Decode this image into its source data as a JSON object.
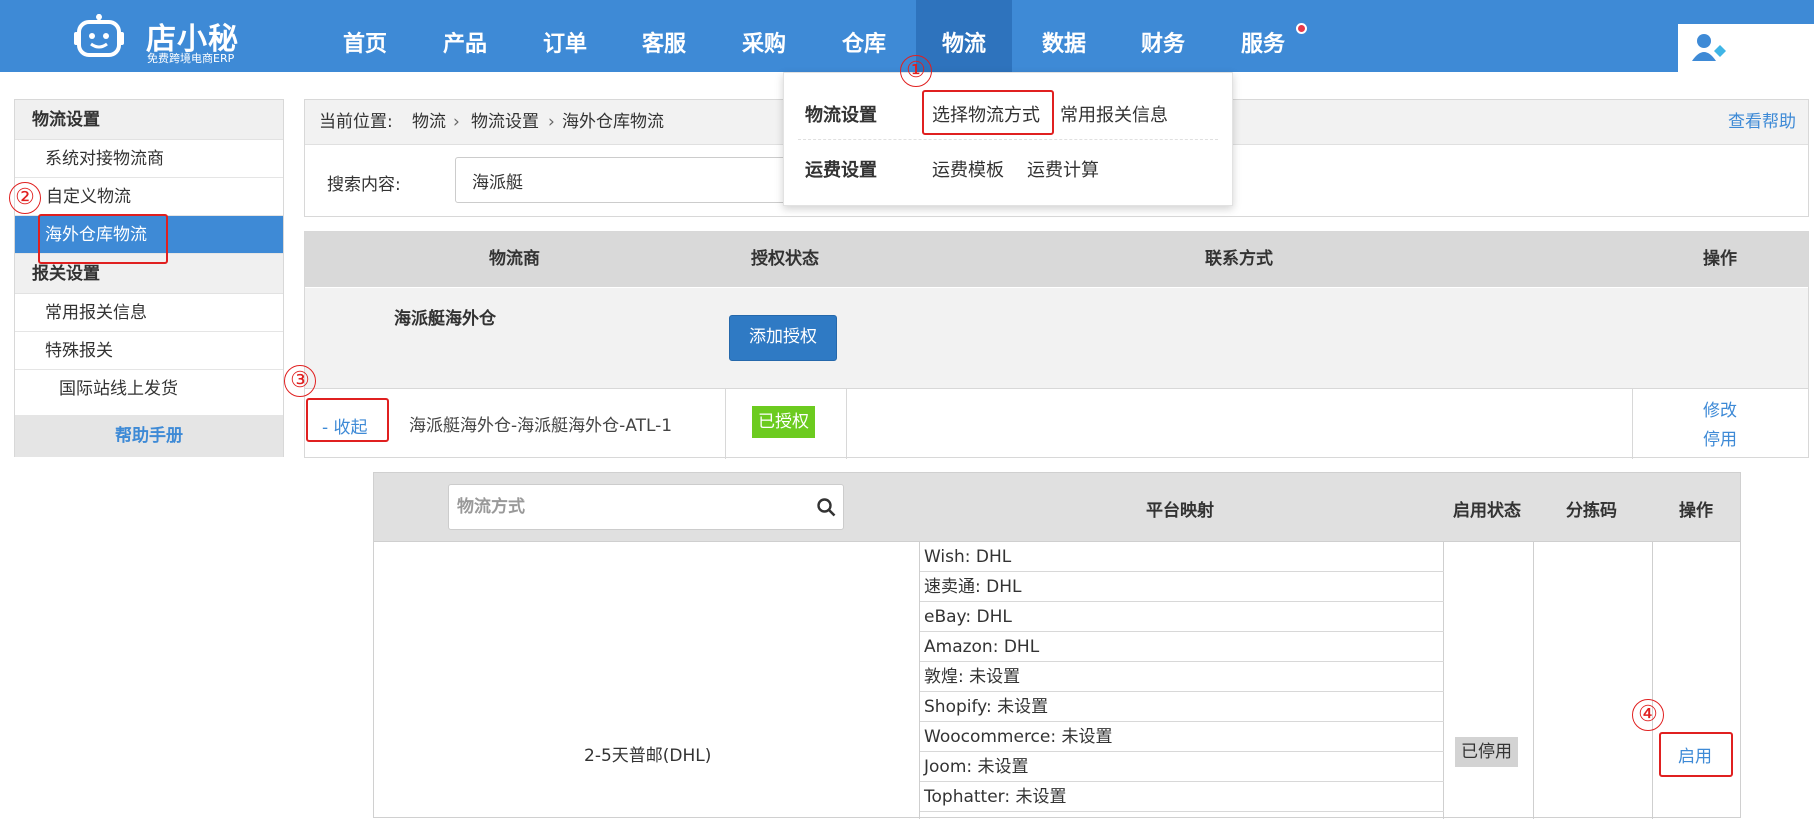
{
  "app": {
    "logo_name": "店小秘",
    "logo_sub": "免费跨境电商ERP"
  },
  "nav": {
    "items": [
      "首页",
      "产品",
      "订单",
      "客服",
      "采购",
      "仓库",
      "物流",
      "数据",
      "财务",
      "服务"
    ],
    "active": "物流"
  },
  "dropdown": {
    "section1_label": "物流设置",
    "section1_items": [
      "选择物流方式",
      "常用报关信息"
    ],
    "section2_label": "运费设置",
    "section2_items": [
      "运费模板",
      "运费计算"
    ]
  },
  "annotations": [
    "①",
    "②",
    "③",
    "④"
  ],
  "sidebar": {
    "group1": "物流设置",
    "group1_items": [
      "系统对接物流商",
      "自定义物流",
      "海外仓库物流"
    ],
    "group2": "报关设置",
    "group2_items": [
      "常用报关信息",
      "特殊报关"
    ],
    "sub_item": "国际站线上发货",
    "help": "帮助手册"
  },
  "breadcrumb": {
    "prefix": "当前位置:",
    "path": [
      "物流",
      "物流设置",
      "海外仓库物流"
    ],
    "help_link": "查看帮助"
  },
  "search": {
    "label": "搜索内容:",
    "value": "海派艇"
  },
  "provider_table": {
    "headers": [
      "物流商",
      "授权状态",
      "联系方式",
      "操作"
    ],
    "group_name": "海派艇海外仓",
    "auth_button": "添加授权",
    "row": {
      "toggle": "- 收起",
      "name": "海派艇海外仓-海派艇海外仓-ATL-1",
      "status": "已授权",
      "actions": [
        "修改",
        "停用"
      ]
    }
  },
  "method_table": {
    "search_placeholder": "物流方式",
    "headers": [
      "平台映射",
      "启用状态",
      "分拣码",
      "操作"
    ],
    "row": {
      "method": "2-5天普邮(DHL)",
      "mappings": [
        "Wish:  DHL",
        "速卖通:  DHL",
        "eBay:  DHL",
        "Amazon:  DHL",
        "敦煌:  未设置",
        "Shopify:  未设置",
        "Woocommerce:  未设置",
        "Joom:  未设置",
        "Tophatter:  未设置"
      ],
      "status": "已停用",
      "action": "启用"
    }
  },
  "colors": {
    "nav_bg": "#3e8ad6",
    "nav_active": "#2e73bd",
    "annotation_red": "#e02020",
    "authorized_green": "#6ccb1f",
    "link_blue": "#3e8ad6"
  }
}
